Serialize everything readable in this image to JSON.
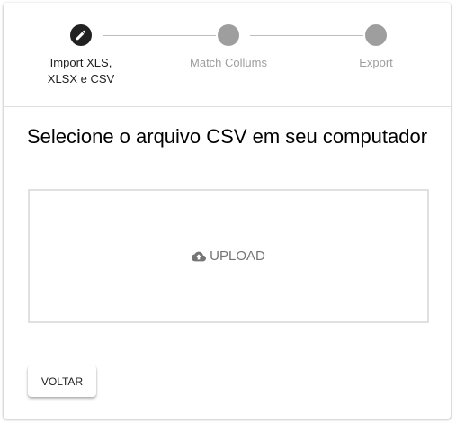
{
  "stepper": {
    "steps": [
      {
        "label": "Import XLS, XLSX e CSV",
        "state": "active",
        "icon": "pencil-icon"
      },
      {
        "label": "Match Collums",
        "state": "inactive",
        "icon": "circle"
      },
      {
        "label": "Export",
        "state": "inactive",
        "icon": "circle"
      }
    ]
  },
  "main": {
    "title": "Selecione o arquivo CSV em seu computador",
    "upload": {
      "label": "UPLOAD",
      "icon": "cloud-upload-icon"
    }
  },
  "footer": {
    "back_label": "VOLTAR"
  },
  "colors": {
    "active_step": "#212121",
    "inactive_step": "#9e9e9e",
    "divider": "#e0e0e0",
    "upload_text": "#757575"
  }
}
